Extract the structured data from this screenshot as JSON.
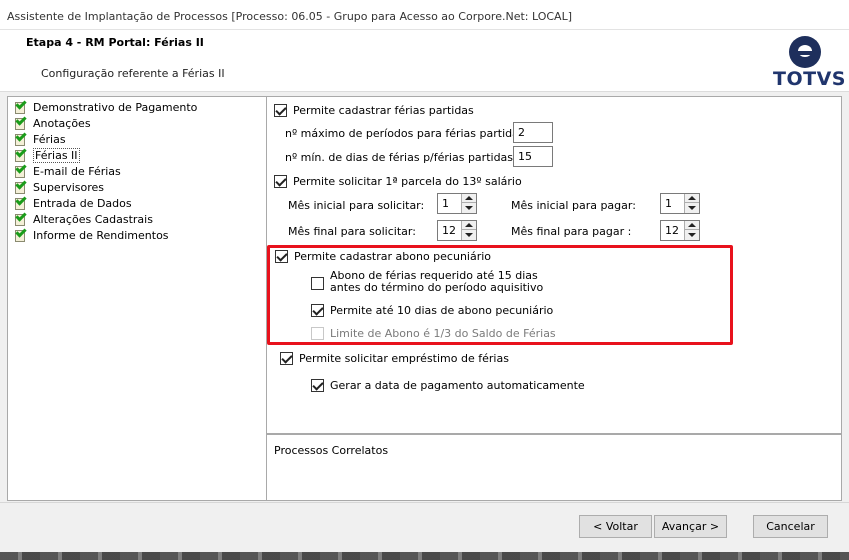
{
  "window": {
    "title": "Assistente de Implantação de Processos [Processo: 06.05 - Grupo para Acesso ao Corpore.Net: LOCAL]"
  },
  "header": {
    "step_title": "Etapa 4 - RM Portal: Férias II",
    "step_subtitle": "Configuração referente a Férias II",
    "logo_text": "TOTVS"
  },
  "sidebar": {
    "items": [
      {
        "label": "Demonstrativo de Pagamento",
        "icon": "checked-document-icon"
      },
      {
        "label": "Anotações",
        "icon": "checked-document-icon"
      },
      {
        "label": "Férias",
        "icon": "checked-document-icon"
      },
      {
        "label": "Férias II",
        "icon": "checked-document-icon",
        "selected": true
      },
      {
        "label": "E-mail de Férias",
        "icon": "checked-document-icon"
      },
      {
        "label": "Supervisores",
        "icon": "checked-document-icon"
      },
      {
        "label": "Entrada de Dados",
        "icon": "checked-document-icon"
      },
      {
        "label": "Alterações Cadastrais",
        "icon": "checked-document-icon"
      },
      {
        "label": "Informe de Rendimentos",
        "icon": "checked-document-icon"
      }
    ]
  },
  "form": {
    "ferias_partidas": {
      "label": "Permite cadastrar férias partidas",
      "checked": true,
      "max_periodos_label": "nº máximo de períodos para férias partidas:",
      "max_periodos_value": "2",
      "min_dias_label": "nº mín. de dias de férias p/férias partidas:",
      "min_dias_value": "15"
    },
    "parcela_13": {
      "label": "Permite solicitar 1ª parcela do 13º salário",
      "checked": true,
      "mes_inicial_solicitar_label": "Mês inicial para solicitar:",
      "mes_inicial_solicitar_value": "1",
      "mes_inicial_pagar_label": "Mês inicial para pagar:",
      "mes_inicial_pagar_value": "1",
      "mes_final_solicitar_label": "Mês final para solicitar:",
      "mes_final_solicitar_value": "12",
      "mes_final_pagar_label": "Mês final para pagar :",
      "mes_final_pagar_value": "12"
    },
    "abono": {
      "label": "Permite cadastrar abono pecuniário",
      "checked": true,
      "requerido_label": "Abono de férias requerido até 15 dias antes do término do período aquisitivo",
      "requerido_checked": false,
      "ate_10_dias_label": "Permite até 10 dias de abono pecuniário",
      "ate_10_dias_checked": true,
      "limite_label": "Limite de Abono é 1/3 do Saldo de Férias",
      "limite_checked": false,
      "limite_disabled": true
    },
    "emprestimo": {
      "label": "Permite solicitar empréstimo de férias",
      "checked": true,
      "gerar_data_label": "Gerar a data de pagamento automaticamente",
      "gerar_data_checked": true
    }
  },
  "related": {
    "label": "Processos Correlatos"
  },
  "buttons": {
    "back": "< Voltar",
    "next": "Avançar >",
    "cancel": "Cancelar"
  },
  "colors": {
    "highlight_border": "#e8111c",
    "logo_blue": "#20356d"
  }
}
